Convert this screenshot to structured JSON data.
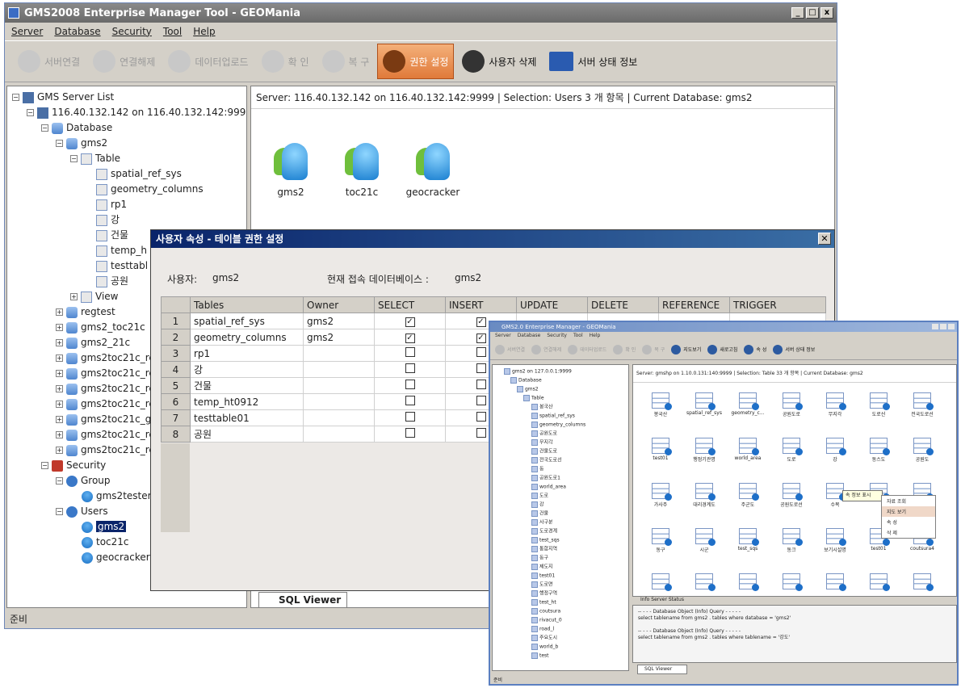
{
  "main": {
    "title": "GMS2008 Enterprise Manager Tool - GEOMania",
    "window_buttons": [
      "_",
      "□",
      "x"
    ],
    "menus": [
      "Server",
      "Database",
      "Security",
      "Tool",
      "Help"
    ],
    "toolbar": [
      {
        "label": "서버연결",
        "state": "disabled"
      },
      {
        "label": "연결해제",
        "state": "disabled"
      },
      {
        "label": "데이터업로드",
        "state": "disabled"
      },
      {
        "label": "확 인",
        "state": "disabled"
      },
      {
        "label": "복 구",
        "state": "disabled"
      },
      {
        "label": "권한 설정",
        "state": "active"
      },
      {
        "label": "사용자 삭제",
        "state": "enabled"
      },
      {
        "label": "서버 상태 정보",
        "state": "enabled"
      }
    ],
    "tree": {
      "root": "GMS Server List",
      "server": "116.40.132.142 on 116.40.132.142:9999",
      "database": "Database",
      "gms2": "gms2",
      "table": "Table",
      "tables": [
        "spatial_ref_sys",
        "geometry_columns",
        "rp1",
        "강",
        "건물",
        "temp_h",
        "testtabl",
        "공원"
      ],
      "view": "View",
      "databases": [
        "regtest",
        "gms2_toc21c",
        "gms2_21c",
        "gms2toc21c_re",
        "gms2toc21c_re",
        "gms2toc21c_re",
        "gms2toc21c_re",
        "gms2toc21c_gi",
        "gms2toc21c_re",
        "gms2toc21c_re"
      ],
      "security": "Security",
      "group": "Group",
      "group_member": "gms2tester",
      "users": "Users",
      "user_list": [
        "gms2",
        "toc21c",
        "geocracker"
      ]
    },
    "right_status": "Server: 116.40.132.142 on 116.40.132.142:9999 | Selection: Users   3 개 항목 | Current Database: gms2",
    "user_icons": [
      "gms2",
      "toc21c",
      "geocracker"
    ],
    "sql_tab": "SQL Viewer",
    "statusbar": "준비"
  },
  "dialog": {
    "title": "사용자 속성 - 테이블 권한 설정",
    "user_label": "사용자:",
    "user_value": "gms2",
    "db_label": "현재 접속 데이터베이스 :",
    "db_value": "gms2",
    "columns": [
      "Tables",
      "Owner",
      "SELECT",
      "INSERT",
      "UPDATE",
      "DELETE",
      "REFERENCE",
      "TRIGGER"
    ],
    "rows": [
      {
        "num": "1",
        "table": "spatial_ref_sys",
        "owner": "gms2",
        "select": true,
        "insert": true
      },
      {
        "num": "2",
        "table": "geometry_columns",
        "owner": "gms2",
        "select": true,
        "insert": true
      },
      {
        "num": "3",
        "table": "rp1",
        "owner": "",
        "select": false,
        "insert": false
      },
      {
        "num": "4",
        "table": "강",
        "owner": "",
        "select": false,
        "insert": false
      },
      {
        "num": "5",
        "table": "건물",
        "owner": "",
        "select": false,
        "insert": false
      },
      {
        "num": "6",
        "table": "temp_ht0912",
        "owner": "",
        "select": false,
        "insert": false
      },
      {
        "num": "7",
        "table": "testtable01",
        "owner": "",
        "select": false,
        "insert": false
      },
      {
        "num": "8",
        "table": "공원",
        "owner": "",
        "select": false,
        "insert": false
      }
    ]
  },
  "inset": {
    "title": "GMS2.0 Enterprise Manager - GEOMania",
    "menus": [
      "Server",
      "Database",
      "Security",
      "Tool",
      "Help"
    ],
    "toolbar": [
      {
        "label": "서버연결",
        "state": "disabled"
      },
      {
        "label": "연결해제",
        "state": "disabled"
      },
      {
        "label": "데이터업로드",
        "state": "disabled"
      },
      {
        "label": "확 인",
        "state": "disabled"
      },
      {
        "label": "복 구",
        "state": "disabled"
      },
      {
        "label": "지도보기",
        "state": "enabled"
      },
      {
        "label": "새로고침",
        "state": "enabled"
      },
      {
        "label": "속 성",
        "state": "enabled"
      },
      {
        "label": "서버 상태 정보",
        "state": "enabled"
      }
    ],
    "status": "Server: gmshp on 1.10.0.131:140:9999 | Selection: Table   33 개 항목 | Current Database: gms2",
    "tree_items": [
      "gms2 on 127.0.0.1:9999",
      "Database",
      "gms2",
      "Table",
      "봉국산",
      "spatial_ref_sys",
      "geometry_columns",
      "공원도로",
      "무지각",
      "건물도로",
      "전국도로선",
      "동",
      "공원도로1",
      "world_area",
      "도로",
      "강",
      "건물",
      "사구분",
      "도로경계",
      "test_sqs",
      "통합지역",
      "동구",
      "제도지",
      "test01",
      "도로면",
      "행정구역",
      "test_ht",
      "coutsura",
      "rivacut_0",
      "road_l",
      "주요도시",
      "world_b",
      "test"
    ],
    "icons": [
      "봉국산",
      "spatial_ref_sys",
      "geometry_c...",
      "공원도로",
      "무지각",
      "도로선",
      "전국도로선",
      "test01",
      "행정기관명",
      "world_area",
      "도로",
      "강",
      "동스도",
      "공원도",
      "가사주",
      "대리경계도",
      "주군도",
      "공원도로선",
      "수목",
      "",
      "",
      "동구",
      "시군",
      "test_sqs",
      "동크",
      "보기시설명",
      "test01",
      "coutsura4",
      "",
      "",
      "",
      "",
      "",
      "",
      ""
    ],
    "tooltip": "속 정보 표시",
    "context_menu": [
      "자료 조회",
      "지도 보기",
      "속 성",
      "삭 제"
    ],
    "tabs": "Info   Server Status",
    "log_lines": [
      "-- - - - Database Object (Info) Query - - - - -",
      "select tablename from gms2 . tables where database = 'gms2'",
      "",
      "-- - - - Database Object (Info) Query - - - - -",
      "select tablename from gms2 . tables where tablename = '강도'"
    ],
    "sql_tab": "SQL Viewer",
    "statusbar": "준비"
  }
}
